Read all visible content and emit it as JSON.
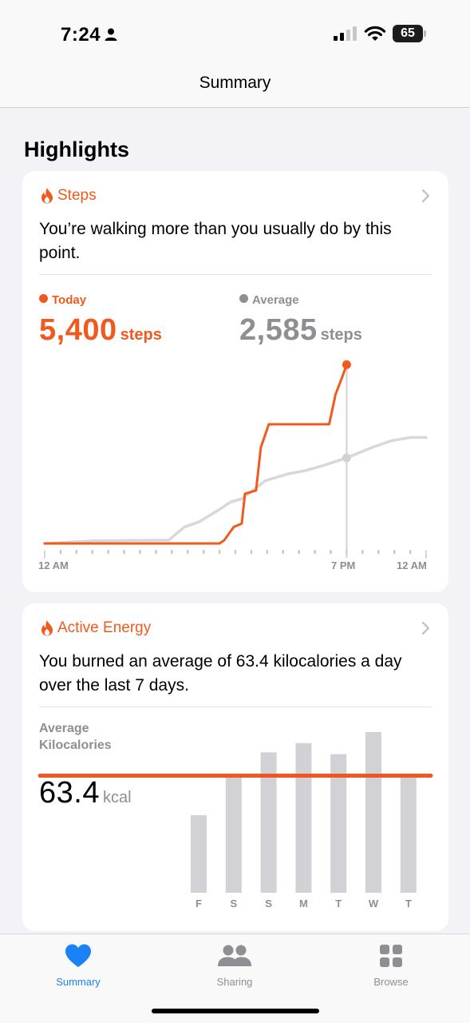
{
  "status": {
    "time": "7:24",
    "battery": "65"
  },
  "nav": {
    "title": "Summary"
  },
  "section": {
    "title": "Highlights"
  },
  "steps_card": {
    "title": "Steps",
    "message": "You’re walking more than you usually do by this point.",
    "today_label": "Today",
    "today_value": "5,400",
    "today_unit": "steps",
    "average_label": "Average",
    "average_value": "2,585",
    "average_unit": "steps",
    "x_labels": [
      "12 AM",
      "7 PM",
      "12 AM"
    ],
    "colors": {
      "today": "#f05a1e",
      "average": "#8e8e93"
    }
  },
  "energy_card": {
    "title": "Active Energy",
    "message": "You burned an average of 63.4 kilocalories a day over the last 7 days.",
    "average_label": "Average Kilocalories",
    "average_value": "63.4",
    "average_unit": "kcal"
  },
  "chart_data": [
    {
      "type": "line",
      "xlabel": "",
      "ylabel": "",
      "x_ticks": [
        "12 AM",
        "7 PM",
        "12 AM"
      ],
      "series": [
        {
          "name": "Today",
          "x_hours": [
            0,
            11,
            11.3,
            11.9,
            12.4,
            12.6,
            13.3,
            13.6,
            14.1,
            15.3,
            17.9,
            18.3,
            18.7,
            19.0
          ],
          "values": [
            0,
            0,
            100,
            500,
            600,
            1500,
            1600,
            2900,
            3600,
            3600,
            3600,
            4500,
            5000,
            5400
          ]
        },
        {
          "name": "Average",
          "x_hours": [
            0,
            3,
            7.8,
            8.3,
            8.8,
            9.7,
            10.9,
            11.7,
            12.4,
            13.9,
            15.3,
            16.4,
            17.5,
            19.0,
            20.6,
            21.8,
            23.0,
            24.0
          ],
          "values": [
            0,
            80,
            100,
            300,
            500,
            650,
            1000,
            1250,
            1350,
            1900,
            2100,
            2200,
            2350,
            2585,
            2900,
            3100,
            3200,
            3200
          ]
        }
      ],
      "highlight_x_hours": 19
    },
    {
      "type": "bar",
      "categories": [
        "F",
        "S",
        "S",
        "M",
        "T",
        "W",
        "T"
      ],
      "values": [
        42,
        63,
        76,
        81,
        75,
        87,
        64
      ],
      "average_line": 63.4,
      "colors": {
        "bar": "#d1d1d6",
        "average_line": "#f04f17"
      }
    }
  ],
  "tabs": [
    {
      "label": "Summary",
      "icon": "heart-icon",
      "active": true
    },
    {
      "label": "Sharing",
      "icon": "people-icon",
      "active": false
    },
    {
      "label": "Browse",
      "icon": "grid-icon",
      "active": false
    }
  ]
}
